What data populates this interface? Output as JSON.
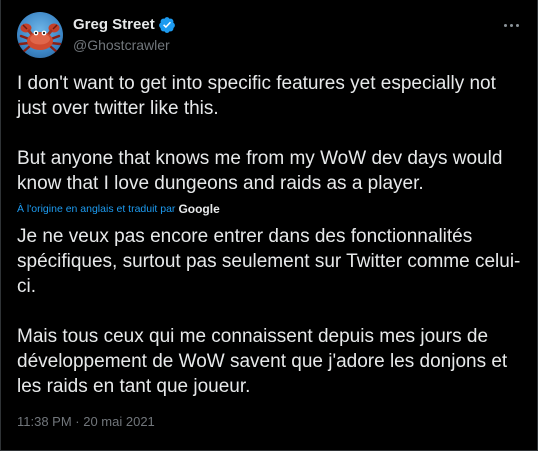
{
  "author": {
    "display_name": "Greg Street",
    "handle": "@Ghostcrawler",
    "verified": true,
    "avatar_icon": "crab-avatar"
  },
  "tweet": {
    "original_text": "I don't want to get into specific features yet especially not just over twitter like this.\n\nBut anyone that knows me from my WoW dev days would know that I love dungeons and raids as a player.",
    "translation_label": "À l'origine en anglais et traduit par",
    "translation_provider": "Google",
    "translated_text": "Je ne veux pas encore entrer dans des fonctionnalités spécifiques, surtout pas seulement sur Twitter comme celui-ci.\n\nMais tous ceux qui me connaissent depuis mes jours de développement de WoW savent que j'adore les donjons et les raids en tant que joueur.",
    "timestamp": "11:38 PM · 20 mai 2021"
  },
  "colors": {
    "background": "#000000",
    "text": "#e7e9ea",
    "secondary_text": "#71767b",
    "accent": "#1d9bf0",
    "verified_badge": "#1d9bf0"
  }
}
